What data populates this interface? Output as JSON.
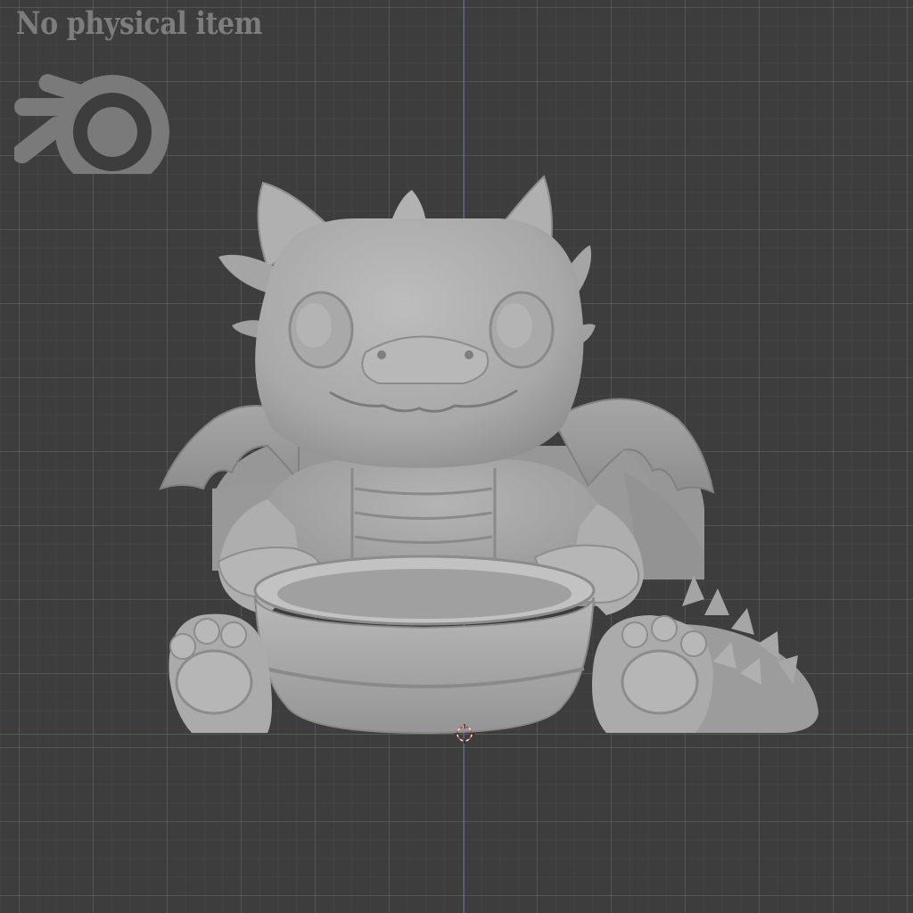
{
  "viewport": {
    "watermark_text": "No physical item",
    "logo_icon": "blender-logo-icon",
    "model_icon": "baby-dragon-with-bowl-model",
    "cursor_icon": "3d-cursor-icon",
    "colors": {
      "background": "#3d3d3d",
      "grid_line": "#505050",
      "axis_x": "#9a4444",
      "axis_y": "#5476a8",
      "model": "#a7a7a7",
      "watermark": "#7d7d7d"
    }
  }
}
